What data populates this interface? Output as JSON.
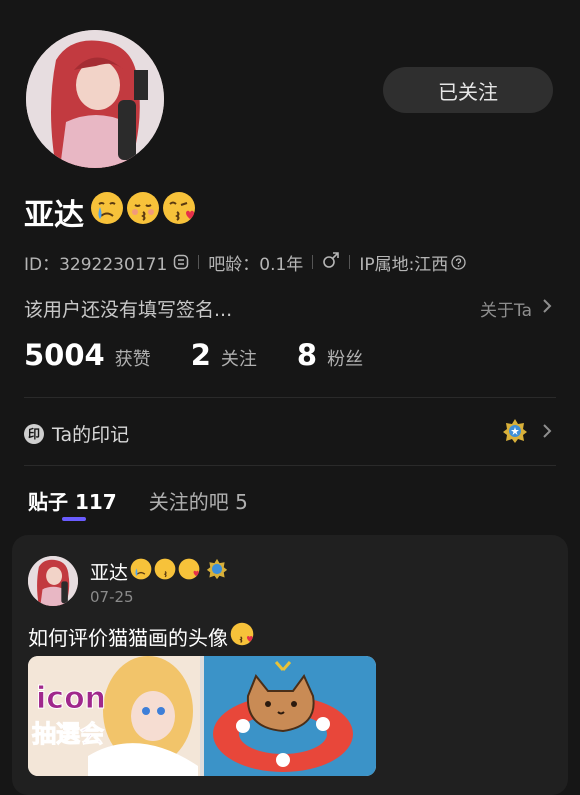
{
  "profile": {
    "username": "亚达",
    "emojis": [
      "crying",
      "kissing",
      "kissing-heart"
    ],
    "follow_label": "已关注",
    "id_text": "ID：3292230171",
    "age_text": "吧龄：0.1年",
    "gender": "male",
    "ip_text": "IP属地:江西",
    "signature": "该用户还没有填写签名...",
    "about_label": "关于Ta"
  },
  "stats": [
    {
      "num": "5004",
      "label": "获赞"
    },
    {
      "num": "2",
      "label": "关注"
    },
    {
      "num": "8",
      "label": "粉丝"
    }
  ],
  "imprint": {
    "icon_text": "印",
    "label": "Ta的印记"
  },
  "tabs": [
    {
      "label": "贴子 117",
      "active": true
    },
    {
      "label": "关注的吧 5",
      "active": false
    }
  ],
  "post": {
    "author": "亚达",
    "date": "07-25",
    "title": "如何评价猫猫画的头像",
    "image_text": "icon\n抽選会"
  },
  "colors": {
    "background": "#161616",
    "tab_indicator": "#6a5cff",
    "button_bg": "#2f2f2f"
  }
}
